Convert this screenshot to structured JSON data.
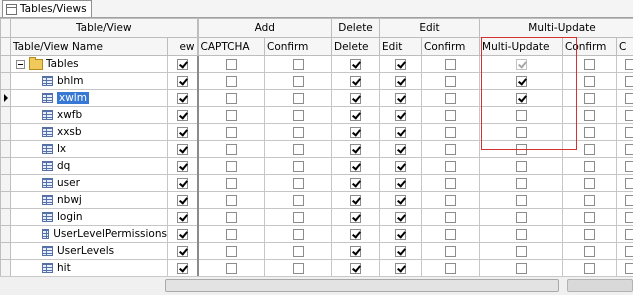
{
  "tab": {
    "label": "Tables/Views"
  },
  "groups": [
    "Table/View",
    "Add",
    "Delete",
    "Edit",
    "Multi-Update"
  ],
  "columns": [
    "Table/View Name",
    "ew",
    "CAPTCHA",
    "Confirm",
    "Delete",
    "Edit",
    "Confirm",
    "Multi-Update",
    "Confirm",
    "C"
  ],
  "root": {
    "label": "Tables"
  },
  "rows": [
    {
      "name": "bhlm",
      "checks": [
        1,
        0,
        0,
        1,
        1,
        0,
        1,
        0,
        0
      ],
      "selected": false
    },
    {
      "name": "xwlm",
      "checks": [
        1,
        0,
        0,
        1,
        1,
        0,
        1,
        0,
        0
      ],
      "selected": true
    },
    {
      "name": "xwfb",
      "checks": [
        1,
        0,
        0,
        1,
        1,
        0,
        0,
        0,
        0
      ],
      "selected": false
    },
    {
      "name": "xxsb",
      "checks": [
        1,
        0,
        0,
        1,
        1,
        0,
        0,
        0,
        0
      ],
      "selected": false
    },
    {
      "name": "lx",
      "checks": [
        1,
        0,
        0,
        1,
        1,
        0,
        0,
        0,
        0
      ],
      "selected": false
    },
    {
      "name": "dq",
      "checks": [
        1,
        0,
        0,
        1,
        1,
        0,
        0,
        0,
        0
      ],
      "selected": false
    },
    {
      "name": "user",
      "checks": [
        1,
        0,
        0,
        1,
        1,
        0,
        0,
        0,
        0
      ],
      "selected": false
    },
    {
      "name": "nbwj",
      "checks": [
        1,
        0,
        0,
        1,
        1,
        0,
        0,
        0,
        0
      ],
      "selected": false
    },
    {
      "name": "login",
      "checks": [
        1,
        0,
        0,
        1,
        1,
        0,
        0,
        0,
        0
      ],
      "selected": false
    },
    {
      "name": "UserLevelPermissions",
      "checks": [
        1,
        0,
        0,
        1,
        1,
        0,
        0,
        0,
        0
      ],
      "selected": false
    },
    {
      "name": "UserLevels",
      "checks": [
        1,
        0,
        0,
        1,
        1,
        0,
        0,
        0,
        0
      ],
      "selected": false
    },
    {
      "name": "hit",
      "checks": [
        1,
        0,
        0,
        1,
        1,
        0,
        0,
        0,
        0
      ],
      "selected": false
    }
  ],
  "root_checks": [
    1,
    0,
    0,
    1,
    1,
    0,
    1,
    0,
    0
  ]
}
